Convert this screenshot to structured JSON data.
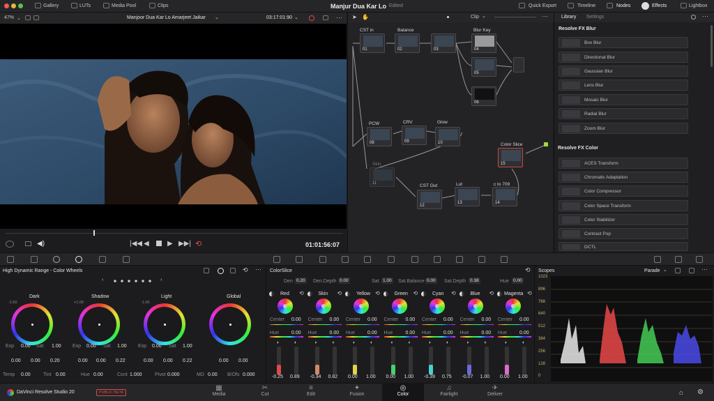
{
  "topbar": {
    "gallery": "Gallery",
    "luts": "LUTs",
    "media_pool": "Media Pool",
    "clips": "Clips",
    "project": "Manjur Dua Kar Lo",
    "status": "Edited",
    "quick_export": "Quick Export",
    "timeline": "Timeline",
    "nodes": "Nodes",
    "effects": "Effects",
    "lightbox": "Lightbox"
  },
  "viewer": {
    "zoom": "47%",
    "clip_name": "Manjoor Dua Kar Lo Amarjeet Jaikar",
    "timecode": "03:17:01:90",
    "playhead_timecode": "01:01:56:07"
  },
  "node_editor": {
    "mode": "Clip",
    "nodes": [
      {
        "label": "CST in",
        "id": "01"
      },
      {
        "label": "Balance",
        "id": "02"
      },
      {
        "label": "",
        "id": "03"
      },
      {
        "label": "Blur Key",
        "id": "04"
      },
      {
        "label": "",
        "id": "05"
      },
      {
        "label": "",
        "id": "06"
      },
      {
        "label": "PCW",
        "id": "08"
      },
      {
        "label": "CRV",
        "id": "09"
      },
      {
        "label": "Glow",
        "id": "10"
      },
      {
        "label": "Skin",
        "id": "11"
      },
      {
        "label": "CST Out",
        "id": "12"
      },
      {
        "label": "Lut",
        "id": "13"
      },
      {
        "label": "c to 709",
        "id": "14"
      },
      {
        "label": "Color Slice",
        "id": "15"
      }
    ]
  },
  "library": {
    "tab_library": "Library",
    "tab_settings": "Settings",
    "blur_header": "Resolve FX Blur",
    "blur_items": [
      "Box Blur",
      "Directional Blur",
      "Gaussian Blur",
      "Lens Blur",
      "Mosaic Blur",
      "Radial Blur",
      "Zoom Blur"
    ],
    "color_header": "Resolve FX Color",
    "color_items": [
      "ACES Transform",
      "Chromatic Adaptation",
      "Color Compressor",
      "Color Space Transform",
      "Color Stabilizer",
      "Contrast Pop",
      "DCTL"
    ]
  },
  "color_wheels": {
    "title": "High Dynamic Range - Color Wheels",
    "wheels": [
      {
        "name": "Dark",
        "level": "-1.50"
      },
      {
        "name": "Shadow",
        "level": "+1.00"
      },
      {
        "name": "Light",
        "level": "-1.00"
      },
      {
        "name": "Global",
        "level": ""
      }
    ],
    "exp_labels": {
      "exp": "Exp",
      "sat": "Sat"
    },
    "exp_values": [
      {
        "exp": "0.00",
        "sat": "1.00"
      },
      {
        "exp": "0.00",
        "sat": "1.00"
      },
      {
        "exp": "0.00",
        "sat": "1.00"
      }
    ],
    "xyz_values": [
      {
        "x": "0.00",
        "y": "0.00",
        "z": "0.20"
      },
      {
        "x": "0.00",
        "y": "0.00",
        "z": "0.22"
      },
      {
        "x": "0.00",
        "y": "0.00",
        "z": "0.22"
      },
      {
        "x": "0.00",
        "y": "0.00"
      }
    ],
    "bottom": {
      "temp_label": "Temp",
      "temp": "0.00",
      "tint_label": "Tint",
      "tint": "0.00",
      "hue_label": "Hue",
      "hue": "0.00",
      "cont_label": "Cont",
      "cont": "1.000",
      "pivot_label": "Pivot",
      "pivot": "0.000",
      "md_label": "MD",
      "md": "0.00",
      "bofs_label": "B/Ofs",
      "bofs": "0.000"
    }
  },
  "color_slice": {
    "title": "ColorSlice",
    "den_label": "Den",
    "den": "0.20",
    "den_depth_label": "Den.Depth",
    "den_depth": "0.00",
    "sat_label": "Sat",
    "sat": "1.00",
    "sat_balance_label": "Sat.Balance",
    "sat_balance": "0.00",
    "sat_depth_label": "Sat.Depth",
    "sat_depth": "0.38",
    "hue_label": "Hue",
    "hue": "0.00",
    "center_label": "Center",
    "channels": [
      {
        "name": "Red",
        "center": "0.00",
        "hue": "0.00",
        "a": "-0.25",
        "b": "0.89",
        "color": "#e04a4a"
      },
      {
        "name": "Skin",
        "center": "0.00",
        "hue": "0.00",
        "a": "-0.34",
        "b": "0.82",
        "color": "#d08a6a"
      },
      {
        "name": "Yellow",
        "center": "0.00",
        "hue": "0.00",
        "a": "0.00",
        "b": "1.00",
        "color": "#e3d34a"
      },
      {
        "name": "Green",
        "center": "0.00",
        "hue": "0.00",
        "a": "0.00",
        "b": "1.00",
        "color": "#4ad06a"
      },
      {
        "name": "Cyan",
        "center": "0.00",
        "hue": "0.00",
        "a": "-0.39",
        "b": "0.75",
        "color": "#4ad0d0"
      },
      {
        "name": "Blue",
        "center": "0.00",
        "hue": "0.00",
        "a": "-0.07",
        "b": "1.00",
        "color": "#6a6ae0"
      },
      {
        "name": "Magenta",
        "center": "0.00",
        "hue": "0.00",
        "a": "0.00",
        "b": "1.00",
        "color": "#e06ad0"
      }
    ]
  },
  "scopes": {
    "title": "Scopes",
    "mode": "Parade",
    "scale": [
      "1023",
      "896",
      "768",
      "640",
      "512",
      "384",
      "256",
      "128",
      "0"
    ]
  },
  "footer": {
    "app_name": "DaVinci Resolve Studio 20",
    "badge": "PUBLIC BETA",
    "tabs": [
      "Media",
      "Cut",
      "Edit",
      "Fusion",
      "Color",
      "Fairlight",
      "Deliver"
    ],
    "active_tab": "Color"
  }
}
